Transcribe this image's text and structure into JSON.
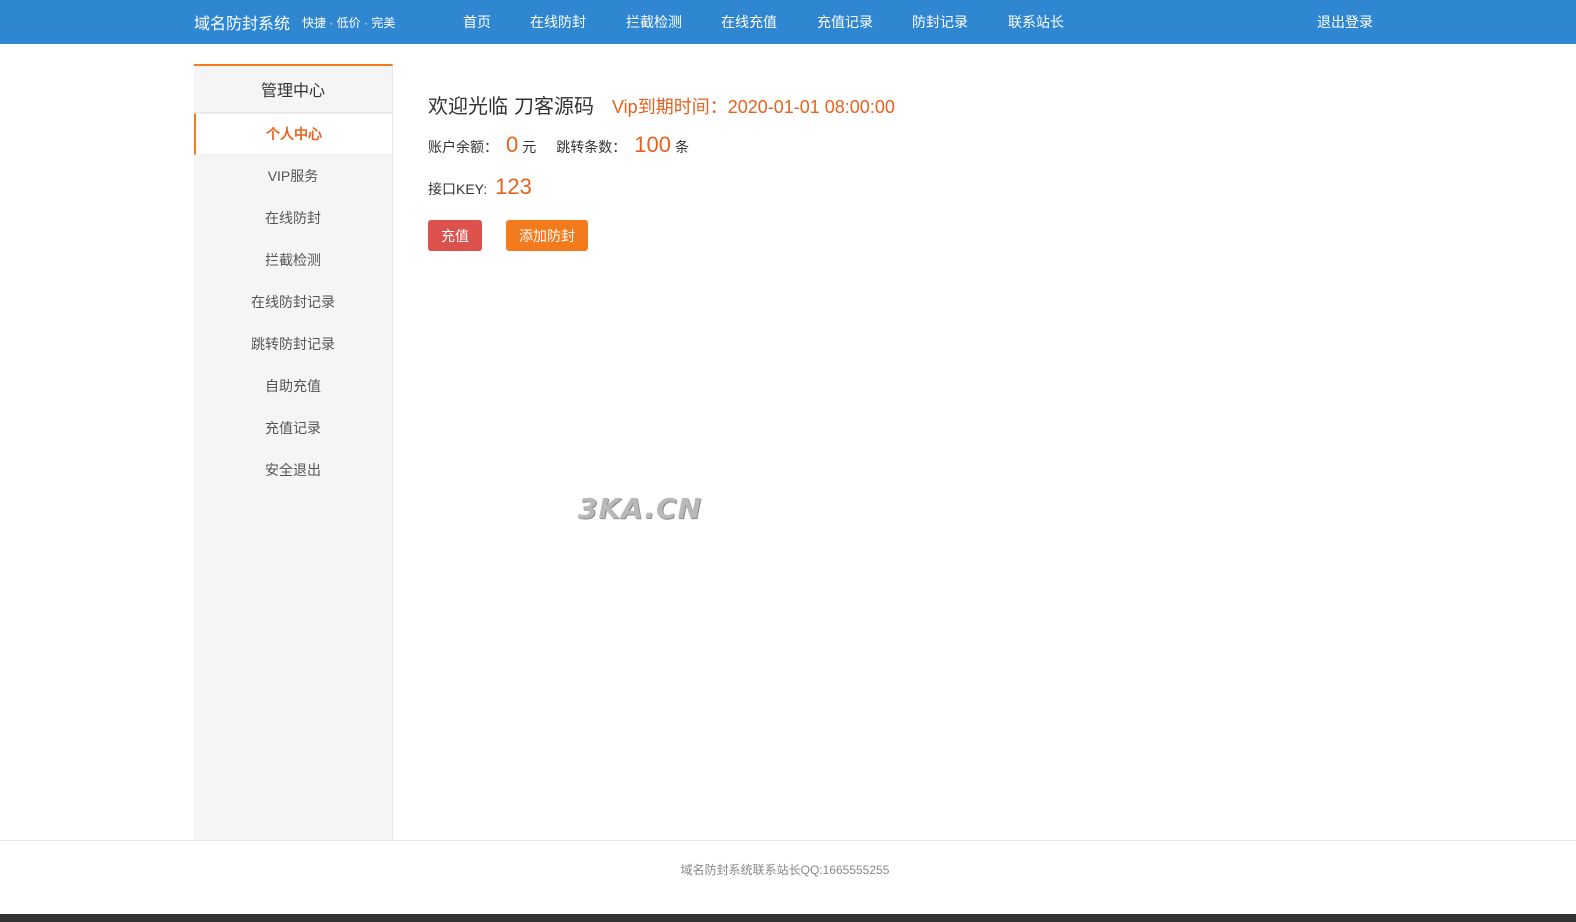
{
  "header": {
    "brand_title": "域名防封系统",
    "brand_slogan": "快捷 · 低价 · 完美",
    "nav": [
      "首页",
      "在线防封",
      "拦截检测",
      "在线充值",
      "充值记录",
      "防封记录",
      "联系站长"
    ],
    "logout_label": "退出登录"
  },
  "sidebar": {
    "title": "管理中心",
    "items": [
      "个人中心",
      "VIP服务",
      "在线防封",
      "拦截检测",
      "在线防封记录",
      "跳转防封记录",
      "自助充值",
      "充值记录",
      "安全退出"
    ],
    "active_index": 0
  },
  "main": {
    "welcome": "欢迎光临",
    "username": "刀客源码",
    "vip_label": "Vip到期时间：",
    "vip_expire": "2020-01-01 08:00:00",
    "balance_label": "账户余额：",
    "balance_value": "0",
    "balance_unit": "元",
    "jumps_label": "跳转条数：",
    "jumps_value": "100",
    "jumps_unit": "条",
    "key_label": "接口KEY:",
    "key_value": "123",
    "recharge_button": "充值",
    "add_button": "添加防封"
  },
  "watermark": "3KA.CN",
  "footer": {
    "text": "域名防封系统联系站长QQ:1665555255"
  },
  "colors": {
    "topbar": "#2f86d1",
    "accent": "#e8611d",
    "recharge_button": "#dd514c",
    "add_button": "#f37b1d"
  }
}
